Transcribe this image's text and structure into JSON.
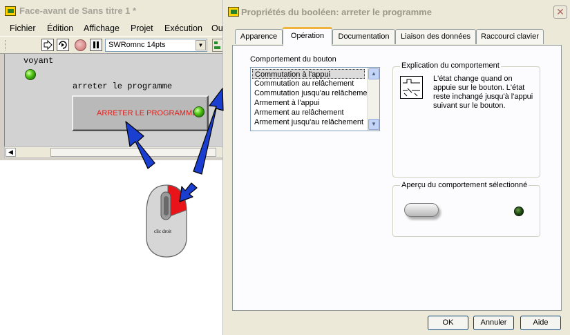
{
  "front_panel": {
    "title": "Face-avant de Sans titre 1 *",
    "menu": [
      "Fichier",
      "Édition",
      "Affichage",
      "Projet",
      "Exécution",
      "Ou"
    ],
    "toolbar": {
      "run_icon": "run-arrow-icon",
      "run_continuous_icon": "run-continuous-icon",
      "abort_icon": "abort-icon",
      "pause_icon": "pause-icon",
      "font": "SWRomnc 14pts"
    },
    "indicator_label": "voyant",
    "button_caption": "arreter le programme",
    "button_text": "ARRETER  LE PROGRAMME",
    "colors": {
      "led_green": "#5fd01e",
      "button_text": "#e0201a"
    }
  },
  "mouse": {
    "text": "clic droit",
    "highlight_color": "#e8141a"
  },
  "arrow_color": "#1a3fd0",
  "dialog": {
    "title": "Propriétés du booléen: arreter le programme",
    "close_icon": "close-icon",
    "tabs": [
      "Apparence",
      "Opération",
      "Documentation",
      "Liaison des données",
      "Raccourci clavier"
    ],
    "active_tab": "Opération",
    "behavior_label": "Comportement du bouton",
    "behaviors": [
      "Commutation à l'appui",
      "Commutation au relâchement",
      "Commutation jusqu'au relâchement",
      "Armement à l'appui",
      "Armement au relâchement",
      "Armement jusqu'au relâchement"
    ],
    "selected_behavior": "Commutation à l'appui",
    "explanation_title": "Explication du comportement",
    "explanation_text": "L'état change quand on appuie sur le bouton.  L'état reste inchangé jusqu'à l'appui suivant sur le bouton.",
    "preview_title": "Aperçu du comportement sélectionné",
    "buttons": {
      "ok": "OK",
      "cancel": "Annuler",
      "help": "Aide"
    }
  }
}
